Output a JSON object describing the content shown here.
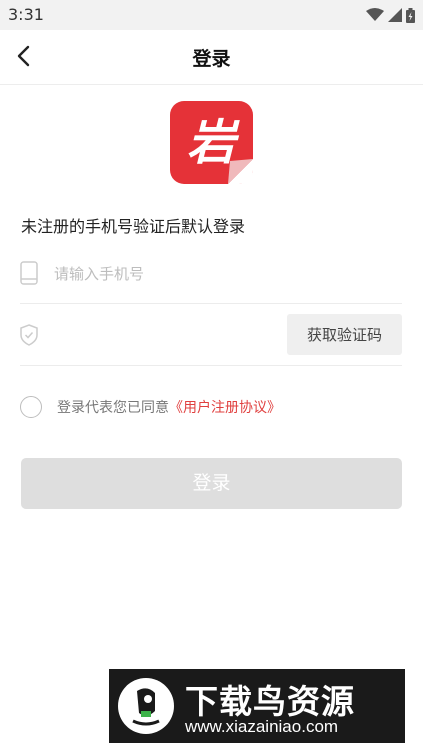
{
  "status_bar": {
    "time": "3:31",
    "icons": [
      "wifi-icon",
      "signal-icon",
      "battery-icon"
    ]
  },
  "nav": {
    "title": "登录",
    "back_icon": "back-arrow-icon"
  },
  "logo": {
    "char": "岩",
    "color": "#e53238"
  },
  "hint": "未注册的手机号验证后默认登录",
  "phone": {
    "placeholder": "请输入手机号",
    "value": "",
    "icon": "phone-icon"
  },
  "code": {
    "placeholder": "",
    "value": "",
    "icon": "shield-check-icon",
    "button_label": "获取验证码"
  },
  "agreement": {
    "text": "登录代表您已同意",
    "link": "《用户注册协议》",
    "checked": false
  },
  "login_button": {
    "label": "登录",
    "enabled": false
  },
  "watermark": {
    "title": "下载鸟资源",
    "url": "www.xiazainiao.com"
  },
  "colors": {
    "accent": "#e0403f",
    "button_disabled": "#dedede"
  }
}
